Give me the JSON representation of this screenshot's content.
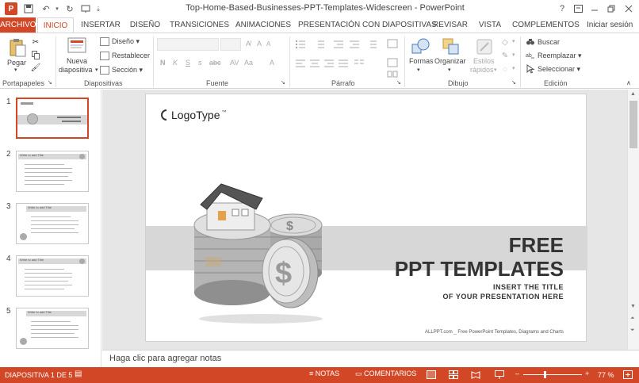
{
  "window": {
    "title": "Top-Home-Based-Businesses-PPT-Templates-Widescreen - PowerPoint",
    "help": "?",
    "app_icon_letter": "P",
    "quick_access": [
      "save-icon",
      "undo-icon",
      "redo-icon",
      "start-presentation-icon"
    ]
  },
  "tabs": [
    {
      "label": "ARCHIVO"
    },
    {
      "label": "INICIO"
    },
    {
      "label": "INSERTAR"
    },
    {
      "label": "DISEÑO"
    },
    {
      "label": "TRANSICIONES"
    },
    {
      "label": "ANIMACIONES"
    },
    {
      "label": "PRESENTACIÓN CON DIAPOSITIVAS"
    },
    {
      "label": "REVISAR"
    },
    {
      "label": "VISTA"
    },
    {
      "label": "COMPLEMENTOS"
    },
    {
      "label": "Iniciar sesión"
    }
  ],
  "ribbon": {
    "clipboard": {
      "paste": "Pegar",
      "group": "Portapapeles"
    },
    "slides": {
      "new_slide": "Nueva",
      "new_slide_2": "diapositiva",
      "layout": "Diseño",
      "reset": "Restablecer",
      "section": "Sección",
      "group": "Diapositivas"
    },
    "font": {
      "bold": "N",
      "italic": "K",
      "underline": "S",
      "strike": "abc",
      "grow": "A",
      "shrink": "A",
      "aa": "Aa",
      "group": "Fuente"
    },
    "paragraph": {
      "group": "Párrafo"
    },
    "drawing": {
      "shapes": "Formas",
      "arrange": "Organizar",
      "styles": "Estilos",
      "styles_2": "rápidos",
      "group": "Dibujo"
    },
    "editing": {
      "find": "Buscar",
      "replace": "Reemplazar",
      "select": "Seleccionar",
      "group": "Edición"
    }
  },
  "thumbnails": [
    {
      "num": "1",
      "selected": true
    },
    {
      "num": "2",
      "selected": false,
      "title": "Write to add Title"
    },
    {
      "num": "3",
      "selected": false,
      "title": "Write to add Title"
    },
    {
      "num": "4",
      "selected": false,
      "title": "Write to add Title"
    },
    {
      "num": "5",
      "selected": false,
      "title": "Write to add Title"
    }
  ],
  "slide": {
    "logo": "LogoType",
    "logo_tm": "™",
    "headline_1": "FREE",
    "headline_2": "PPT TEMPLATES",
    "sub_1": "INSERT THE TITLE",
    "sub_2": "OF YOUR PRESENTATION HERE",
    "footer": "ALLPPT.com _ Free PowerPoint Templates, Diagrams and Charts"
  },
  "notes_placeholder": "Haga clic para agregar notas",
  "status": {
    "slide_info": "DIAPOSITIVA 1 DE 5",
    "notes": "NOTAS",
    "comments": "COMENTARIOS",
    "zoom": "77 %"
  },
  "colors": {
    "accent": "#d24726"
  }
}
